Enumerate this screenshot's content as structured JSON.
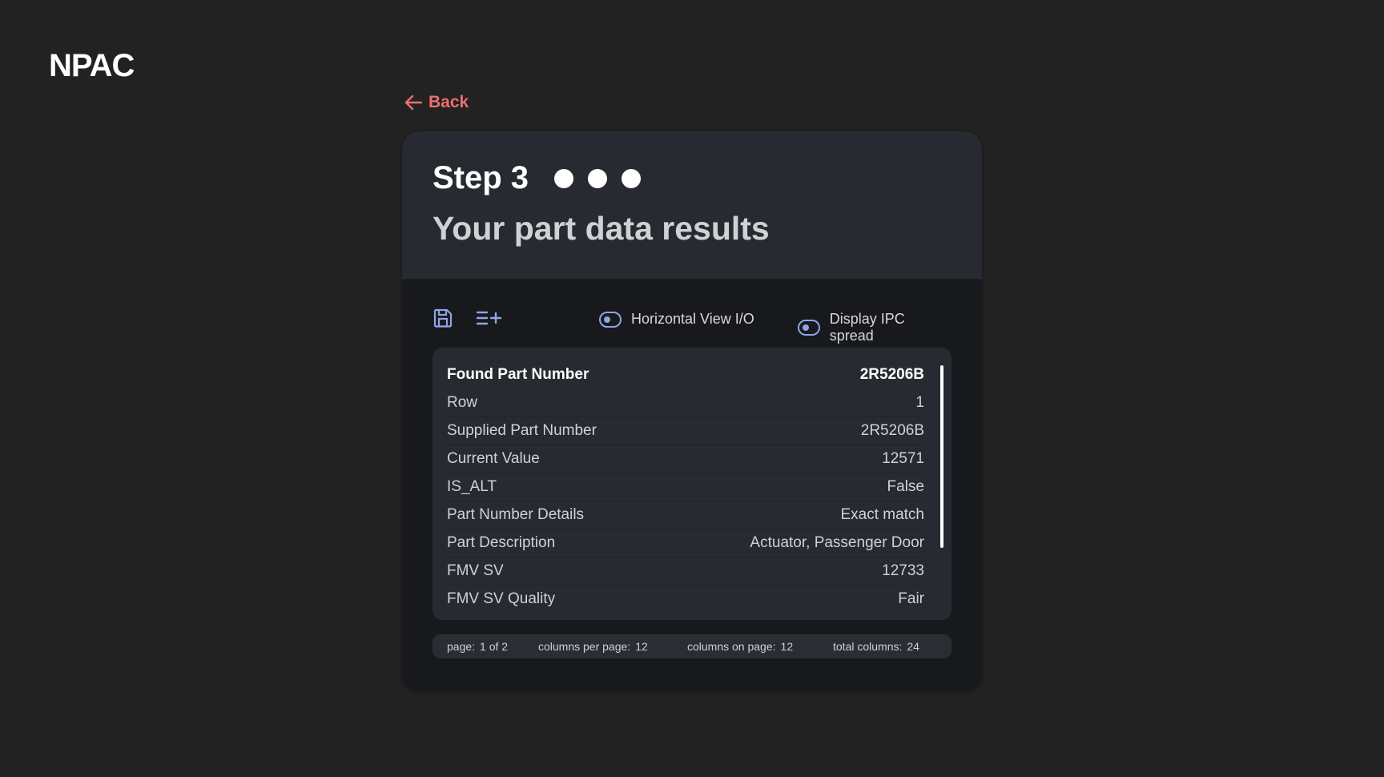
{
  "app": {
    "logo": "NPAC"
  },
  "nav": {
    "back_label": "Back"
  },
  "step": {
    "title": "Step 3",
    "subtitle": "Your part data results"
  },
  "toolbar": {
    "save_icon": "save-icon",
    "add_list_icon": "list-add-icon",
    "toggles": [
      {
        "label": "Horizontal View I/O",
        "on": false
      },
      {
        "label": "Display IPC spread",
        "on": false
      }
    ]
  },
  "table": {
    "header": {
      "label": "Found Part Number",
      "value": "2R5206B"
    },
    "rows": [
      {
        "label": "Row",
        "value": "1"
      },
      {
        "label": "Supplied Part Number",
        "value": "2R5206B"
      },
      {
        "label": "Current Value",
        "value": "12571"
      },
      {
        "label": "IS_ALT",
        "value": "False"
      },
      {
        "label": "Part Number Details",
        "value": "Exact match"
      },
      {
        "label": "Part Description",
        "value": "Actuator, Passenger Door"
      },
      {
        "label": "FMV SV",
        "value": "12733"
      },
      {
        "label": "FMV SV Quality",
        "value": "Fair"
      }
    ]
  },
  "status": {
    "page_label": "page:",
    "page_value": "1 of 2",
    "cpp_label": "columns per page:",
    "cpp_value": "12",
    "cop_label": "columns on page:",
    "cop_value": "12",
    "total_label": "total columns:",
    "total_value": "24"
  },
  "colors": {
    "background": "#222222",
    "accent_back": "#ec6f6f",
    "icon_accent": "#8fa3e6"
  }
}
